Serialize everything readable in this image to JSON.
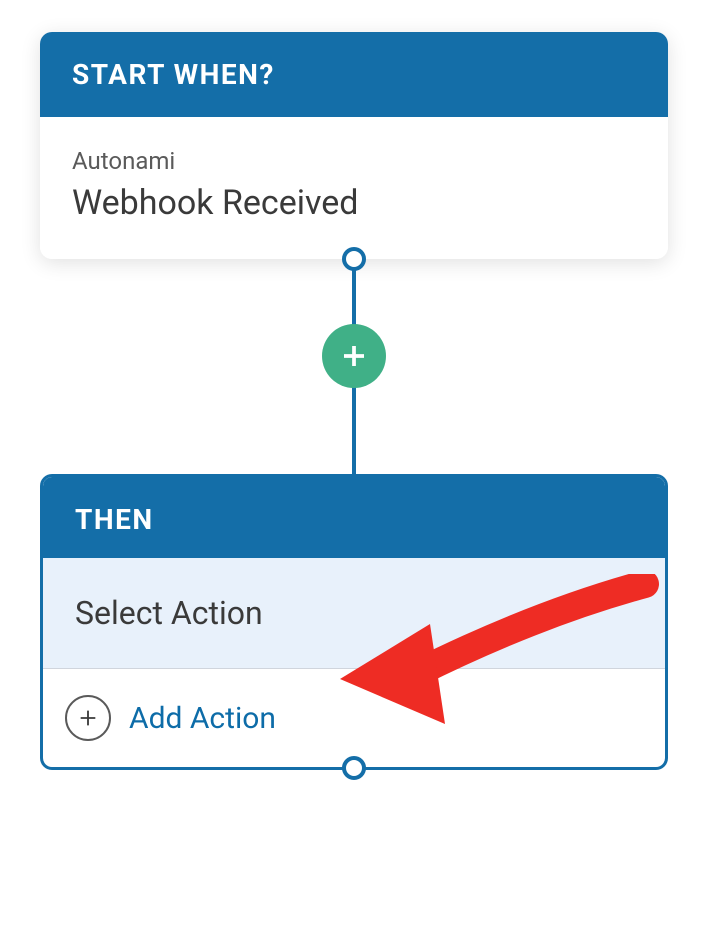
{
  "trigger_card": {
    "header": "START WHEN?",
    "source": "Autonami",
    "event": "Webhook Received"
  },
  "action_card": {
    "header": "THEN",
    "select_action_label": "Select Action",
    "add_action_label": "Add Action"
  },
  "colors": {
    "primary": "#146ea8",
    "accent_green": "#40b087",
    "highlight": "#e8f1fb",
    "arrow": "#e53935"
  }
}
